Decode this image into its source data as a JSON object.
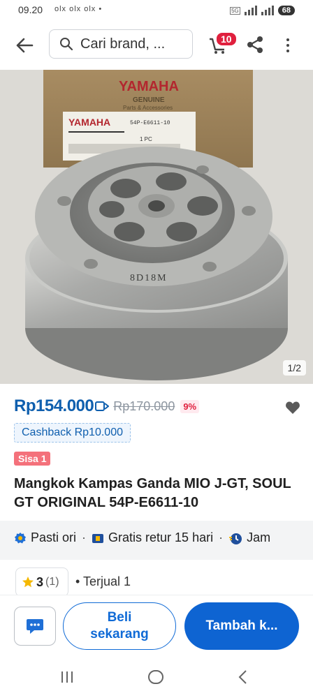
{
  "status_bar": {
    "time": "09.20",
    "notifications": "olx olx olx •",
    "network": "5G",
    "battery": "68"
  },
  "header": {
    "search_placeholder": "Cari brand, ...",
    "cart_count": "10"
  },
  "gallery": {
    "counter": "1/2",
    "photo_text": {
      "brand": "YAMAHA",
      "genuine": "GENUINE",
      "parts": "Parts & Accessories",
      "part_no": "54P-E6611-10",
      "qty": "1 PC",
      "stamp": "8D18M"
    }
  },
  "product": {
    "price": "Rp154.000",
    "original_price": "Rp170.000",
    "discount": "9%",
    "cashback": "Cashback Rp10.000",
    "stock_badge": "Sisa 1",
    "title": "Mangkok Kampas Ganda MIO J-GT, SOUL GT ORIGINAL 54P-E6611-10"
  },
  "features": [
    {
      "label": "Pasti ori"
    },
    {
      "label": "Gratis retur 15 hari"
    },
    {
      "label": "Jam"
    }
  ],
  "stats": {
    "rating": "3",
    "rating_count": "(1)",
    "sold": "• Terjual 1"
  },
  "actions": {
    "buy_now_line1": "Beli",
    "buy_now_line2": "sekarang",
    "add_to_cart": "Tambah k..."
  },
  "colors": {
    "primary_blue": "#0e64d2",
    "price_blue": "#0f5fae",
    "badge_red": "#e0203e",
    "star": "#f5b800"
  },
  "icons": {
    "back": "back-arrow-icon",
    "search": "search-icon",
    "cart": "cart-icon",
    "share": "share-icon",
    "more": "more-vertical-icon",
    "wishlist": "heart-icon",
    "chat": "chat-icon",
    "star": "star-icon"
  }
}
